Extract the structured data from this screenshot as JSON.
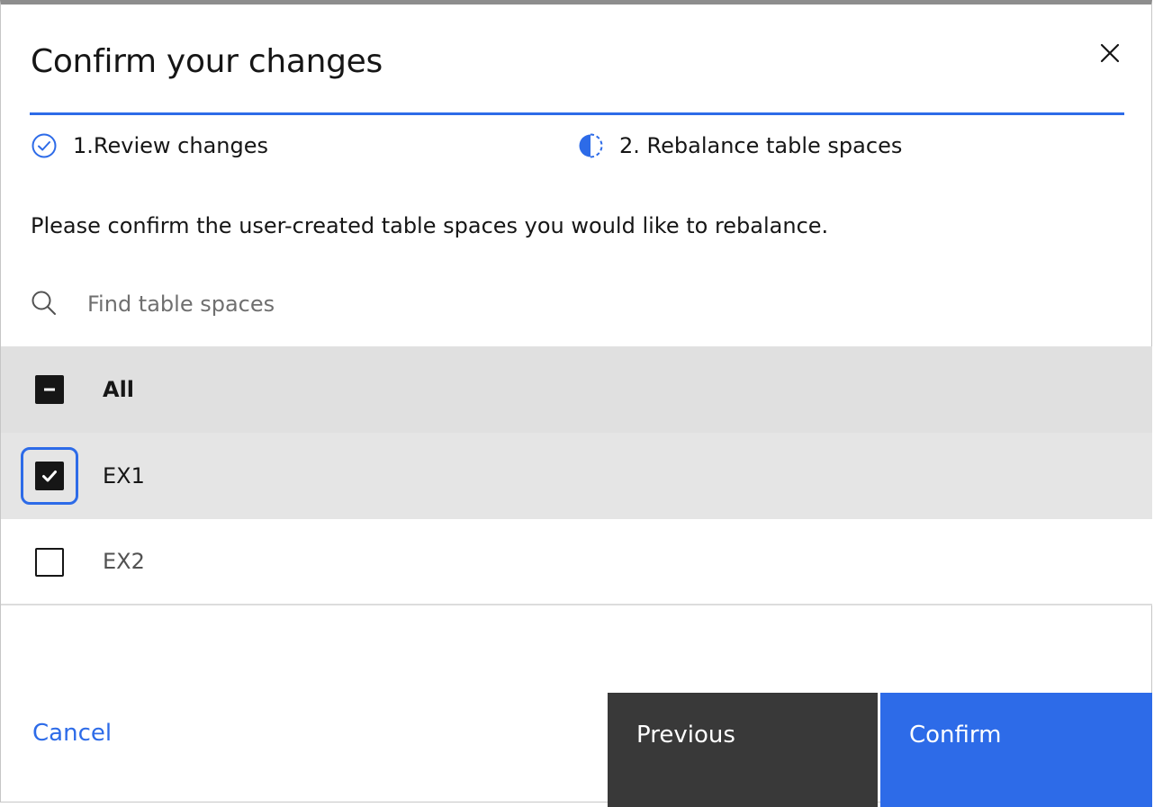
{
  "modal": {
    "title": "Confirm your changes",
    "close_icon": "close-icon"
  },
  "steps": [
    {
      "label": "1.Review changes",
      "status": "complete",
      "icon": "checkmark-outline-icon"
    },
    {
      "label": "2. Rebalance table spaces",
      "status": "current",
      "icon": "incomplete-half-circle-icon"
    }
  ],
  "description": "Please confirm the user-created table spaces you would like to rebalance.",
  "search": {
    "placeholder": "Find table spaces",
    "value": "",
    "icon": "search-icon"
  },
  "table": {
    "select_all_label": "All",
    "select_all_state": "indeterminate",
    "rows": [
      {
        "label": "EX1",
        "checked": true,
        "focused": true
      },
      {
        "label": "EX2",
        "checked": false,
        "focused": false
      }
    ]
  },
  "footer": {
    "cancel_label": "Cancel",
    "previous_label": "Previous",
    "confirm_label": "Confirm"
  },
  "colors": {
    "accent": "#2d6be8",
    "secondary_button": "#393939",
    "text": "#161616",
    "header_row": "#e0e0e0",
    "selected_row": "#e5e5e5"
  }
}
